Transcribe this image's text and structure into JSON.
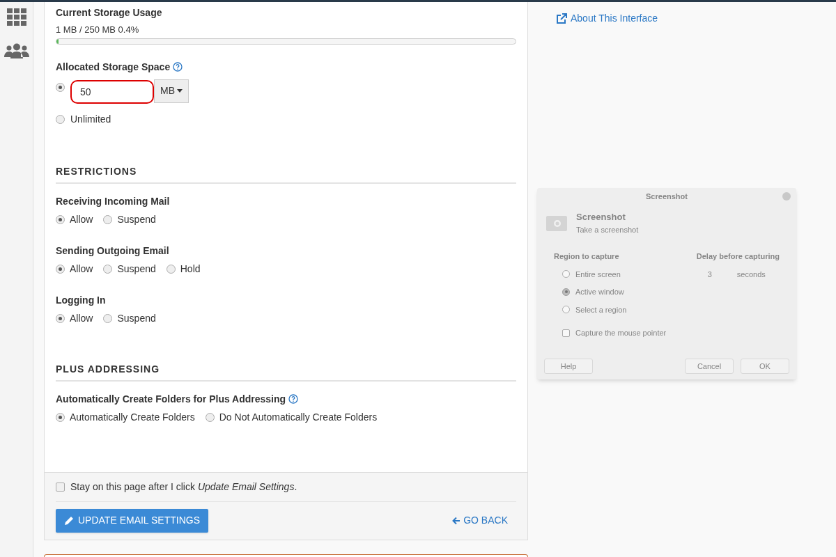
{
  "sidebar": {
    "items": [
      {
        "kind": "apps"
      },
      {
        "kind": "users"
      }
    ]
  },
  "storage_usage": {
    "label": "Current Storage Usage",
    "reading": "1 MB / 250 MB 0.4%",
    "level": 0.004
  },
  "allocated": {
    "label": "Allocated Storage Space",
    "help": true,
    "options": [
      {
        "kind": "input",
        "value": "50",
        "unit": "MB",
        "selected": true,
        "highlighted": true
      },
      {
        "kind": "radio",
        "label": "Unlimited",
        "selected": false
      }
    ]
  },
  "sections": [
    {
      "heading": "RESTRICTIONS",
      "groups": [
        {
          "label": "Receiving Incoming Mail",
          "options": [
            {
              "label": "Allow",
              "selected": true
            },
            {
              "label": "Suspend",
              "selected": false
            }
          ]
        },
        {
          "label": "Sending Outgoing Email",
          "options": [
            {
              "label": "Allow",
              "selected": true
            },
            {
              "label": "Suspend",
              "selected": false
            },
            {
              "label": "Hold",
              "selected": false
            }
          ]
        },
        {
          "label": "Logging In",
          "options": [
            {
              "label": "Allow",
              "selected": true
            },
            {
              "label": "Suspend",
              "selected": false
            }
          ]
        }
      ]
    },
    {
      "heading": "PLUS ADDRESSING",
      "groups": [
        {
          "label": "Automatically Create Folders for Plus Addressing",
          "help": true,
          "options": [
            {
              "label": "Automatically Create Folders",
              "selected": true
            },
            {
              "label": "Do Not Automatically Create Folders",
              "selected": false
            }
          ]
        }
      ]
    }
  ],
  "footer": {
    "stay": {
      "text": "Stay on this page after I click *Update Email Settings*.",
      "checked": false
    },
    "submit": "UPDATE EMAIL SETTINGS",
    "back": "GO BACK"
  },
  "about_link": "About This Interface",
  "dialog": {
    "title": "Screenshot",
    "app_name": "Screenshot",
    "app_subtitle": "Take a screenshot",
    "region_heading": "Region to capture",
    "regions": [
      {
        "label": "Entire screen",
        "selected": false
      },
      {
        "label": "Active window",
        "selected": true
      },
      {
        "label": "Select a region",
        "selected": false
      }
    ],
    "pointer": {
      "label": "Capture the mouse pointer",
      "checked": false
    },
    "delay_heading": "Delay before capturing",
    "delay_value": "3",
    "delay_unit": "seconds",
    "buttons": [
      "Help",
      "Cancel",
      "OK"
    ]
  }
}
